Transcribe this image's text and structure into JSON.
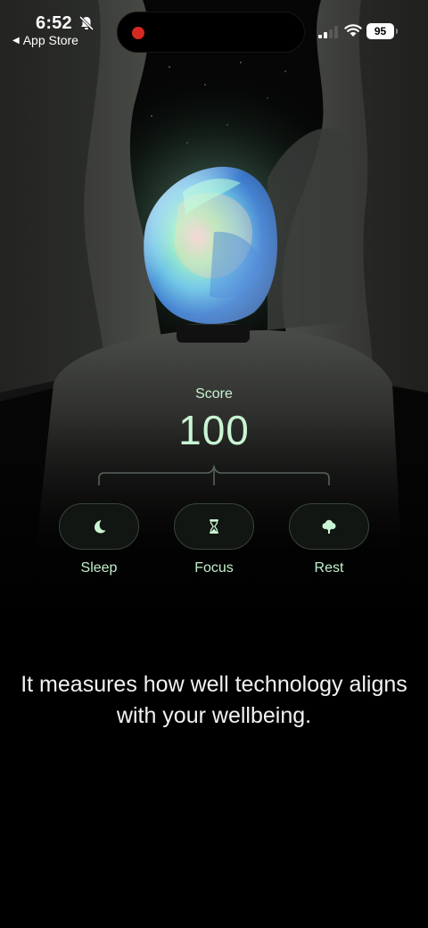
{
  "status_bar": {
    "time": "6:52",
    "back_label": "App Store",
    "battery": "95"
  },
  "score": {
    "label": "Score",
    "value": "100"
  },
  "categories": [
    {
      "label": "Sleep",
      "icon": "moon-icon"
    },
    {
      "label": "Focus",
      "icon": "hourglass-icon"
    },
    {
      "label": "Rest",
      "icon": "tree-icon"
    }
  ],
  "description": "It measures how well technology aligns with your wellbeing.",
  "colors": {
    "accent": "#c9f5d2",
    "background": "#000000",
    "record": "#d62a20"
  }
}
